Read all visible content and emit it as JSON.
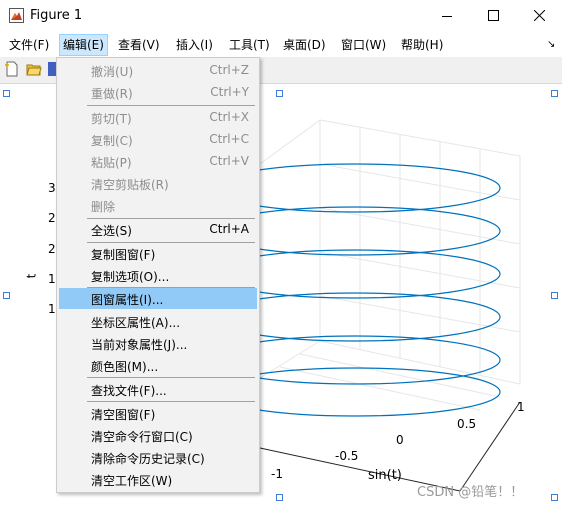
{
  "window": {
    "title": "Figure 1"
  },
  "menubar": {
    "items": [
      {
        "label": "文件(F)"
      },
      {
        "label": "编辑(E)"
      },
      {
        "label": "查看(V)"
      },
      {
        "label": "插入(I)"
      },
      {
        "label": "工具(T)"
      },
      {
        "label": "桌面(D)"
      },
      {
        "label": "窗口(W)"
      },
      {
        "label": "帮助(H)"
      }
    ],
    "overflow": "↘"
  },
  "edit_menu": {
    "items": [
      {
        "label": "撤消(U)",
        "shortcut": "Ctrl+Z",
        "enabled": false
      },
      {
        "label": "重做(R)",
        "shortcut": "Ctrl+Y",
        "enabled": false
      },
      {
        "label": "剪切(T)",
        "shortcut": "Ctrl+X",
        "enabled": false
      },
      {
        "label": "复制(C)",
        "shortcut": "Ctrl+C",
        "enabled": false
      },
      {
        "label": "粘贴(P)",
        "shortcut": "Ctrl+V",
        "enabled": false
      },
      {
        "label": "清空剪贴板(R)",
        "shortcut": "",
        "enabled": false
      },
      {
        "label": "删除",
        "shortcut": "",
        "enabled": false
      },
      {
        "label": "全选(S)",
        "shortcut": "Ctrl+A",
        "enabled": true
      },
      {
        "label": "复制图窗(F)",
        "shortcut": "",
        "enabled": true
      },
      {
        "label": "复制选项(O)...",
        "shortcut": "",
        "enabled": true
      },
      {
        "label": "图窗属性(I)...",
        "shortcut": "",
        "enabled": true,
        "selected": true
      },
      {
        "label": "坐标区属性(A)...",
        "shortcut": "",
        "enabled": true
      },
      {
        "label": "当前对象属性(J)...",
        "shortcut": "",
        "enabled": true
      },
      {
        "label": "颜色图(M)...",
        "shortcut": "",
        "enabled": true
      },
      {
        "label": "查找文件(F)...",
        "shortcut": "",
        "enabled": true
      },
      {
        "label": "清空图窗(F)",
        "shortcut": "",
        "enabled": true
      },
      {
        "label": "清空命令行窗口(C)",
        "shortcut": "",
        "enabled": true
      },
      {
        "label": "清除命令历史记录(C)",
        "shortcut": "",
        "enabled": true
      },
      {
        "label": "清空工作区(W)",
        "shortcut": "",
        "enabled": true
      }
    ]
  },
  "plot": {
    "zlabel": "t",
    "xlabel": "sin(t)",
    "z_ticks_visible": [
      "3",
      "2",
      "2",
      "1",
      "1"
    ],
    "x_ticks": [
      "1",
      "0.5",
      "0",
      "-0.5"
    ],
    "y_ticks": [
      "-1"
    ],
    "line_color": "#0072bd"
  },
  "watermark": "CSDN @铅笔！！"
}
